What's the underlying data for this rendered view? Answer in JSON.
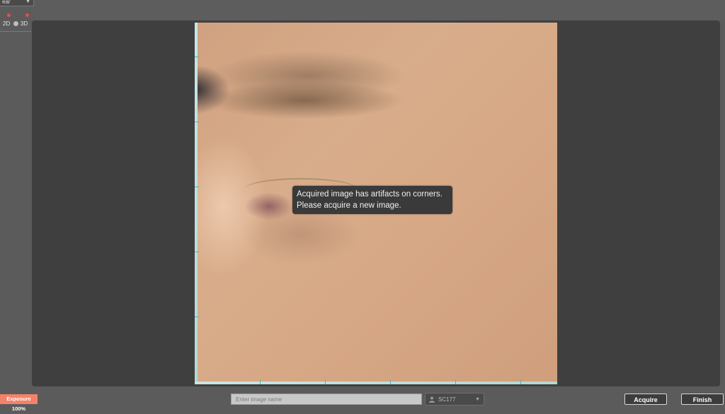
{
  "window": {
    "top_dropdown_label": "ear"
  },
  "left_panel": {
    "mode_2d": "2D",
    "mode_3d": "3D",
    "indicator_colors": [
      "#e05050",
      "#e05050"
    ]
  },
  "viewer": {
    "message_line1": "Acquired image has artifacts on corners.",
    "message_line2": "Please acquire a new image."
  },
  "bottom_bar": {
    "exposure_label": "Exposure 100%",
    "image_name_placeholder": "Enter image name",
    "user_label": "SC177",
    "acquire_label": "Acquire",
    "finish_label": "Finish"
  },
  "colors": {
    "exposure_badge": "#f2836a",
    "viewer_bg": "#3f3f3f",
    "scale_tick": "#3fb9b4"
  }
}
